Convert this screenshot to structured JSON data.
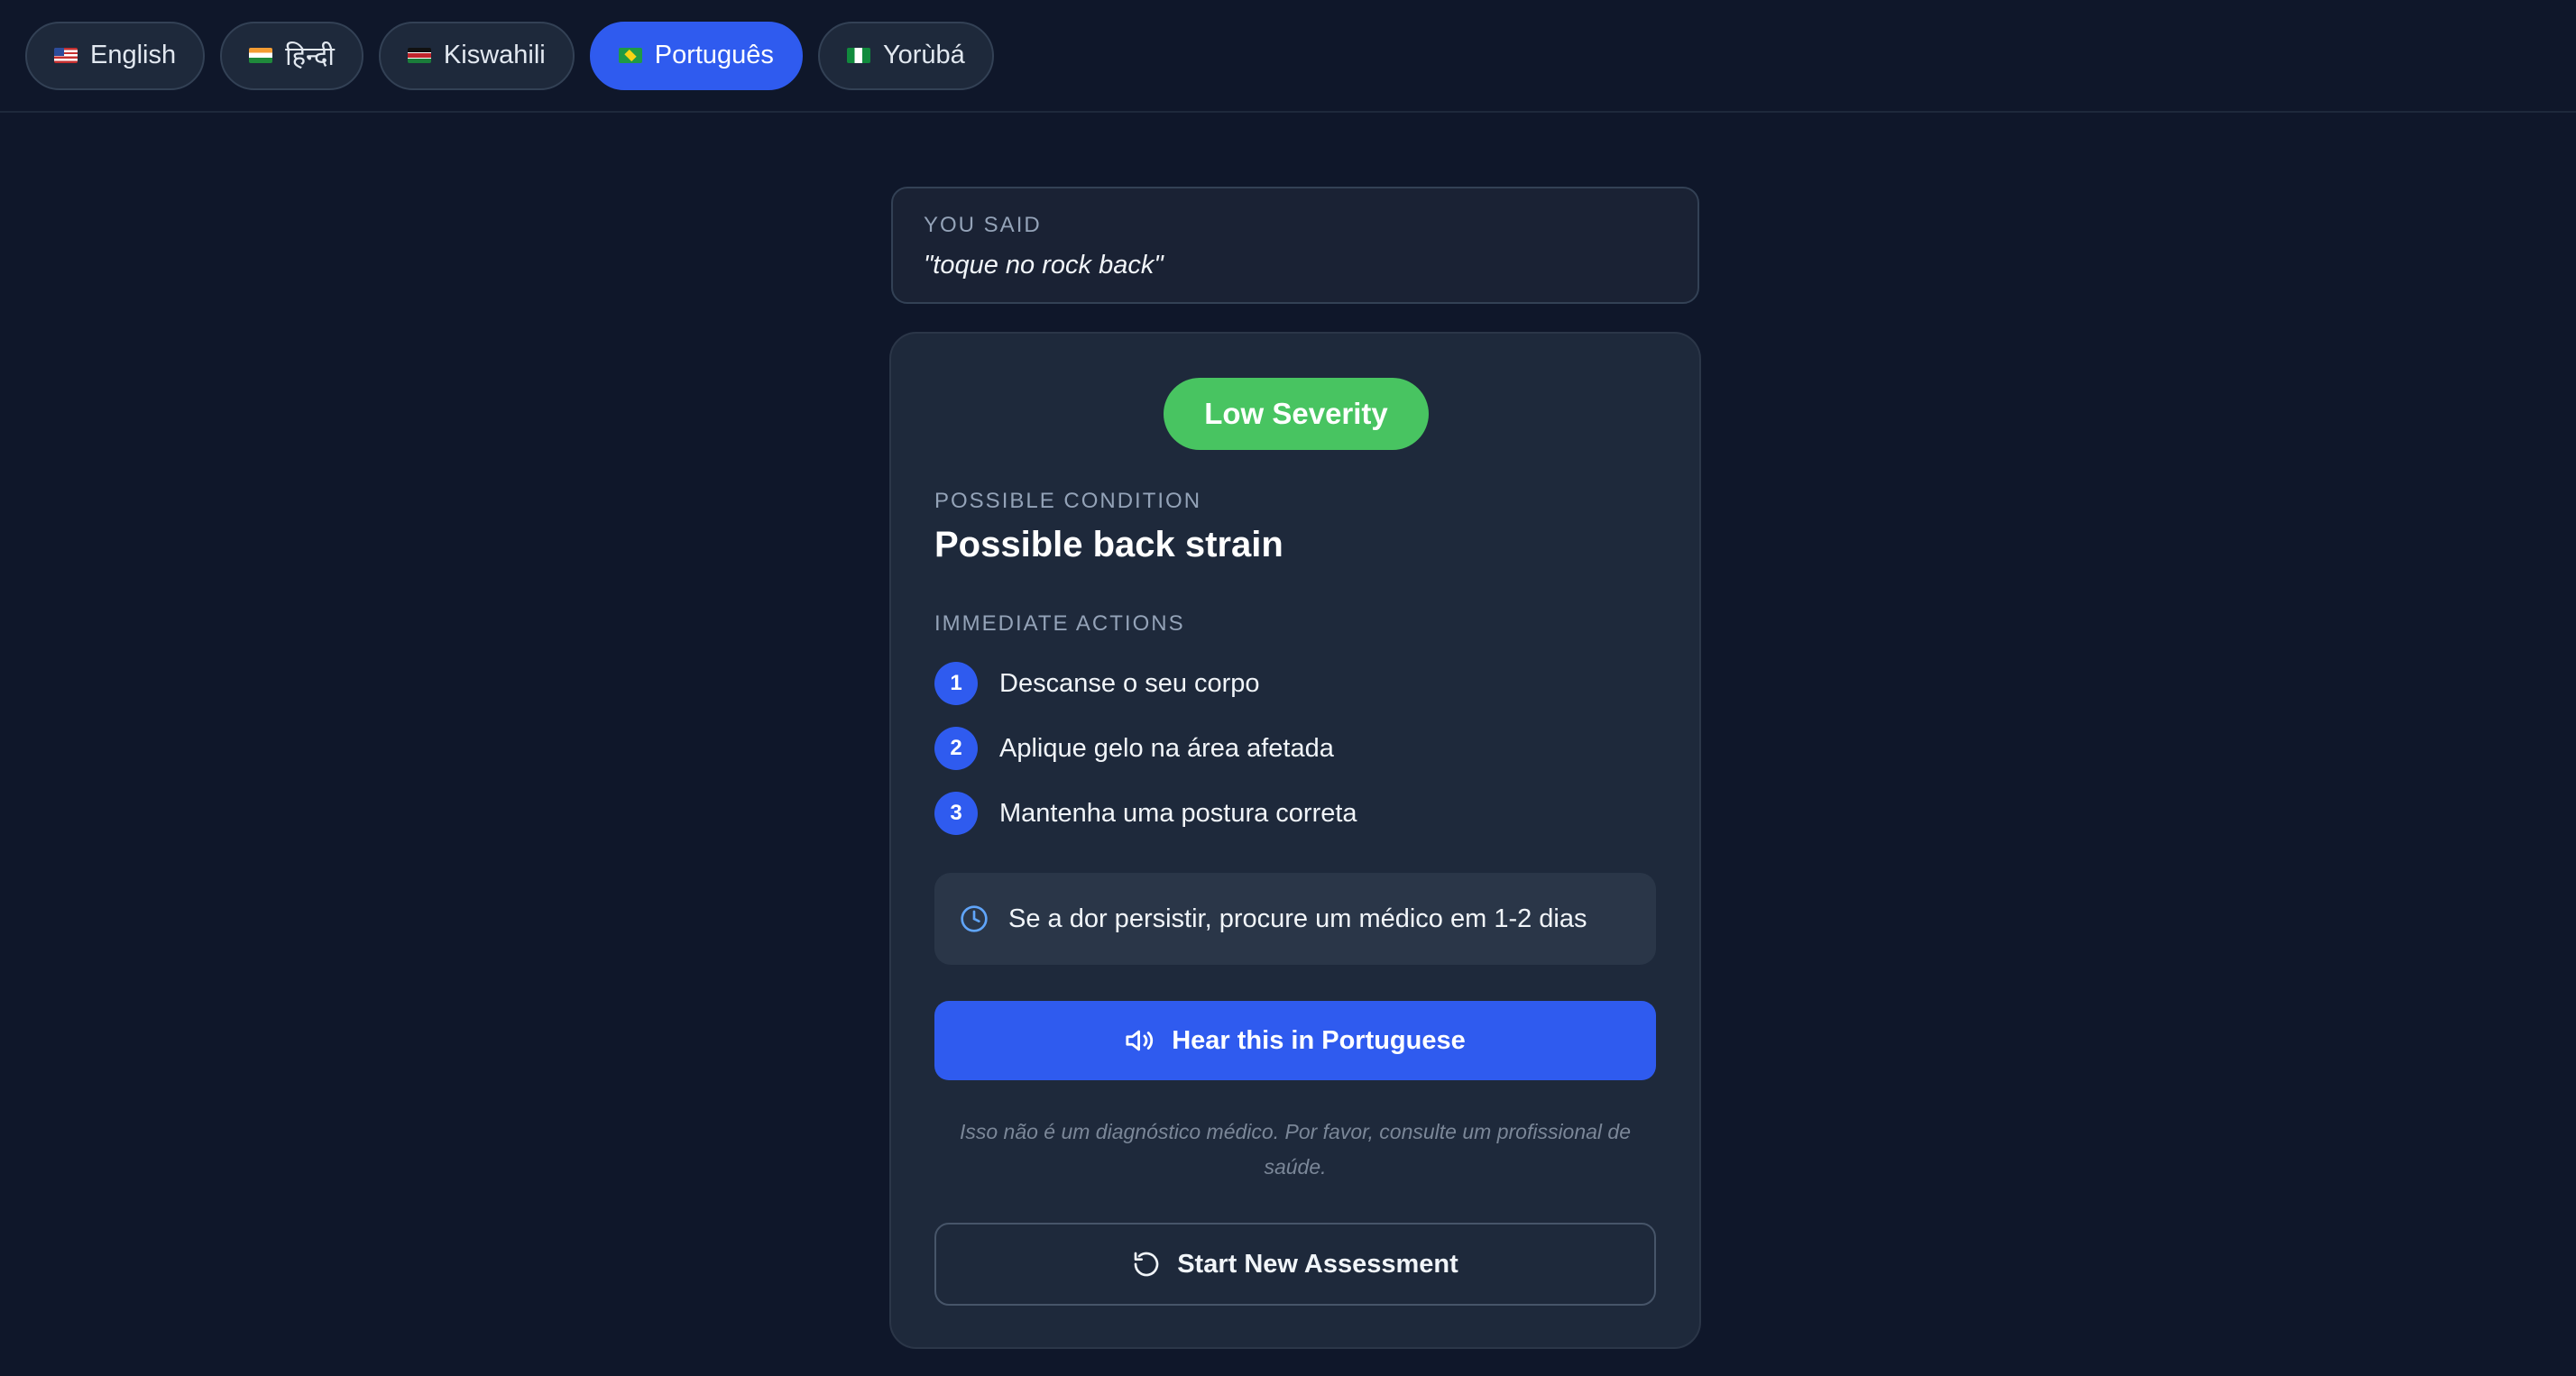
{
  "languages": [
    {
      "label": "English",
      "flag": "us-flag-icon",
      "active": false
    },
    {
      "label": "हिन्दी",
      "flag": "india-flag-icon",
      "active": false
    },
    {
      "label": "Kiswahili",
      "flag": "kenya-flag-icon",
      "active": false
    },
    {
      "label": "Português",
      "flag": "brazil-flag-icon",
      "active": true
    },
    {
      "label": "Yorùbá",
      "flag": "nigeria-flag-icon",
      "active": false
    }
  ],
  "you_said": {
    "label": "YOU SAID",
    "text": "\"toque no rock back\""
  },
  "result": {
    "severity": "Low Severity",
    "severity_color": "#48c461",
    "condition_label": "POSSIBLE CONDITION",
    "condition": "Possible back strain",
    "actions_label": "IMMEDIATE ACTIONS",
    "actions": [
      {
        "num": "1",
        "text": "Descanse o seu corpo"
      },
      {
        "num": "2",
        "text": "Aplique gelo na área afetada"
      },
      {
        "num": "3",
        "text": "Mantenha uma postura correta"
      }
    ],
    "notice": "Se a dor persistir, procure um médico em 1-2 dias",
    "hear_button": "Hear this in Portuguese",
    "disclaimer": "Isso não é um diagnóstico médico. Por favor, consulte um profissional de saúde.",
    "new_assessment_button": "Start New Assessment"
  },
  "colors": {
    "accent": "#2f5bef",
    "background": "#0f172a",
    "card": "#1e293b"
  }
}
